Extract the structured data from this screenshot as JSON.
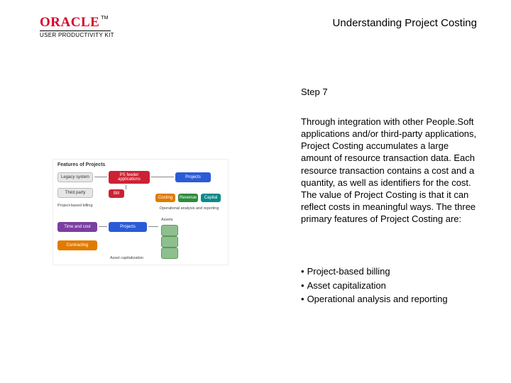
{
  "brand": {
    "name": "ORACLE",
    "tm": "TM",
    "product_line": "USER PRODUCTIVITY KIT"
  },
  "title": "Understanding Project Costing",
  "step_label": "Step 7",
  "body": "Through integration with other People.Soft applications and/or third-party applications, Project Costing accumulates a large amount of resource transaction data. Each resource transaction contains a cost and a quantity, as well as identifiers for the cost. The value of Project Costing is that it can reflect costs in meaningful ways. The three primary features of Project Costing are:",
  "bullets": {
    "marker": "•",
    "b1": "Project-based billing",
    "b2": "Asset capitalization",
    "b3": "Operational analysis and reporting"
  },
  "thumb": {
    "caption": "Features of Projects",
    "legacy": "Legacy system",
    "feeders": "PS feeder applications",
    "projects": "Projects",
    "third": "Third party",
    "bill": "Bill",
    "costing": "Costing",
    "revenue": "Revenue",
    "capital": "Capital",
    "pbb": "Project-based billing",
    "oar": "Operational analysis and reporting",
    "timecost": "Time and cost",
    "projects2": "Projects",
    "contracting": "Contracting",
    "assets": "Assets",
    "acap": "Asset capitalization"
  }
}
